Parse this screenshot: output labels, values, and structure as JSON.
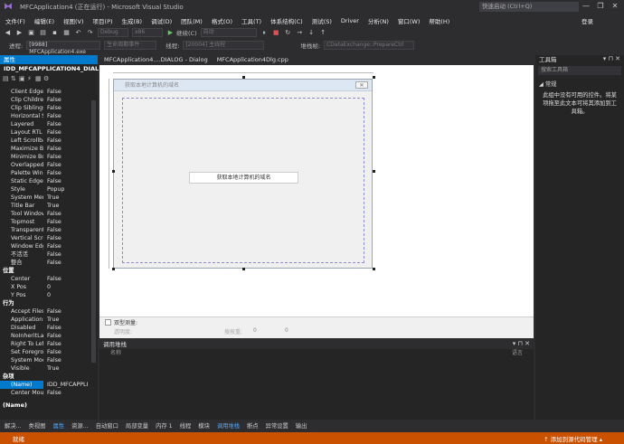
{
  "window": {
    "title": "MFCApplication4 (正在运行) - Microsoft Visual Studio",
    "quick_launch": "快速启动 (Ctrl+Q)",
    "controls": [
      "—",
      "❐",
      "✕"
    ]
  },
  "menu": [
    "文件(F)",
    "编辑(E)",
    "视图(V)",
    "项目(P)",
    "生成(B)",
    "调试(D)",
    "团队(M)",
    "格式(O)",
    "工具(T)",
    "体系结构(C)",
    "测试(S)",
    "Driver",
    "分析(N)",
    "窗口(W)",
    "帮助(H)"
  ],
  "login": "登录",
  "toolbar": {
    "config": "Debug",
    "platform": "x86",
    "continue": "继续(C)",
    "auto": "自动"
  },
  "toolbar2": {
    "process_label": "进程:",
    "process": "[9988] MFCApplication4.exe",
    "lifecycle": "生命周期事件",
    "thread_label": "线程:",
    "thread": "[20004] 主线程",
    "stackframe_label": "堆栈帧:",
    "stackframe": "CDataExchange::PrepareCtrl"
  },
  "properties": {
    "header": "属性",
    "selected": "IDD_MFCAPPLICATION4_DIAL",
    "rows": [
      {
        "n": "Client Edge",
        "v": "False"
      },
      {
        "n": "Clip Children",
        "v": "False"
      },
      {
        "n": "Clip Siblings",
        "v": "False"
      },
      {
        "n": "Horizontal S",
        "v": "False"
      },
      {
        "n": "Layered",
        "v": "False"
      },
      {
        "n": "Layout RTL",
        "v": "False"
      },
      {
        "n": "Left Scrollba",
        "v": "False"
      },
      {
        "n": "Maximize Bo",
        "v": "False"
      },
      {
        "n": "Minimize Bo",
        "v": "False"
      },
      {
        "n": "Overlapped",
        "v": "False"
      },
      {
        "n": "Palette Winc",
        "v": "False"
      },
      {
        "n": "Static Edge",
        "v": "False"
      },
      {
        "n": "Style",
        "v": "Popup"
      },
      {
        "n": "System Men",
        "v": "True"
      },
      {
        "n": "Title Bar",
        "v": "True"
      },
      {
        "n": "Tool Window",
        "v": "False"
      },
      {
        "n": "Topmost",
        "v": "False"
      },
      {
        "n": "Transparent",
        "v": "False"
      },
      {
        "n": "Vertical Scro",
        "v": "False"
      },
      {
        "n": "Window Edg",
        "v": "False"
      },
      {
        "n": "不活活",
        "v": "False"
      },
      {
        "n": "整合",
        "v": "False"
      }
    ],
    "cat_position": "位置",
    "pos_rows": [
      {
        "n": "Center",
        "v": "False"
      },
      {
        "n": "X Pos",
        "v": "0"
      },
      {
        "n": "Y Pos",
        "v": "0"
      }
    ],
    "cat_behavior": "行为",
    "beh_rows": [
      {
        "n": "Accept Files",
        "v": "False"
      },
      {
        "n": "Application",
        "v": "True"
      },
      {
        "n": "Disabled",
        "v": "False"
      },
      {
        "n": "NoInheritLa",
        "v": "False"
      },
      {
        "n": "Right To Left",
        "v": "False"
      },
      {
        "n": "Set Foregro",
        "v": "False"
      },
      {
        "n": "System Mod",
        "v": "False"
      },
      {
        "n": "Visible",
        "v": "True"
      }
    ],
    "cat_misc": "杂项",
    "misc_rows": [
      {
        "n": "(Name)",
        "v": "IDD_MFCAPPLI"
      },
      {
        "n": "Center Mou",
        "v": "False"
      }
    ],
    "desc_title": "(Name)"
  },
  "editor": {
    "tabs": [
      "MFCApplication4....DIALOG - Dialog",
      "MFCApplication4Dlg.cpp"
    ],
    "dialog_caption": "获取本地计算机的域名",
    "button_label": "获取本地计算机的域名",
    "close_glyph": "✕",
    "test_label": "双型测量:",
    "opacity_label": "透明度:",
    "hide_label": "搜按重:",
    "zero": "0"
  },
  "callstack": {
    "title": "调用堆栈",
    "col_name": "名称",
    "col_lang": "语言",
    "ctrls": "▾ ⊓ ✕"
  },
  "toolbox": {
    "title": "工具箱",
    "search": "搜索工具箱",
    "group": "◢ 常规",
    "message": "此组中没有可用的控件。将某项拖至此文本可将其添加到工具箱。",
    "ctrls": "▾ ⊓ ✕"
  },
  "bottom_tabs": [
    "解决...",
    "类视图",
    "属性",
    "资源...",
    "自动窗口",
    "局部变量",
    "内存 1",
    "线程",
    "模块",
    "调用堆栈",
    "断点",
    "异常设置",
    "输出"
  ],
  "active_bottom_tab": "调用堆栈",
  "status": {
    "state": "就绪",
    "source_control": "↑ 添加到源代码管理 ▴"
  }
}
